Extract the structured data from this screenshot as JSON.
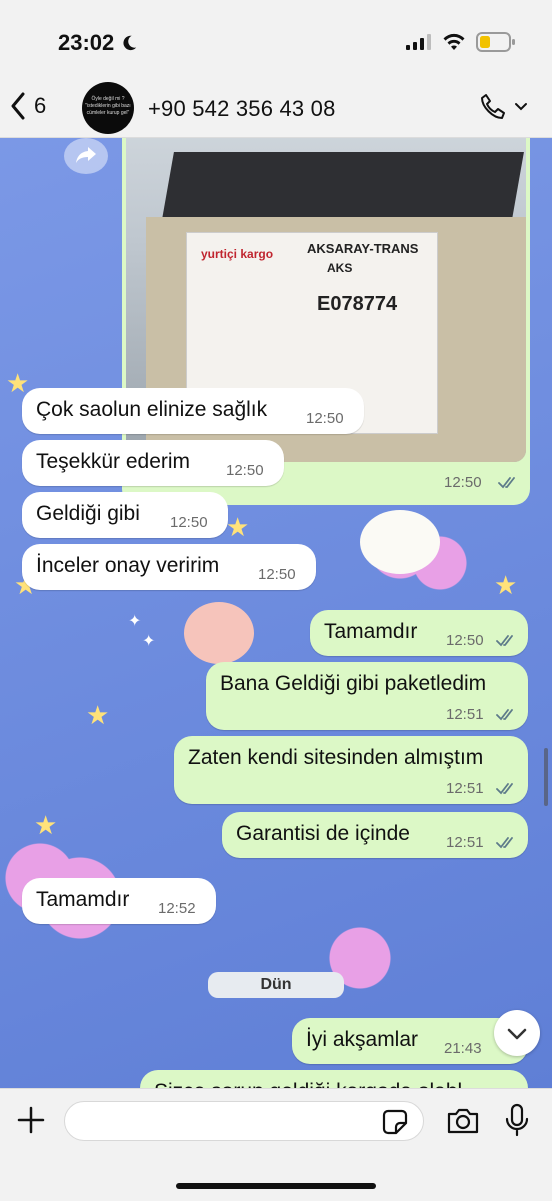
{
  "status": {
    "time": "23:02"
  },
  "header": {
    "back_count": "6",
    "contact": "+90 542 356 43 08",
    "avatar_text": "Öyle değil mi ? \"istediklerin gibi bazı cümleler kurup gel\""
  },
  "photo": {
    "label_title": "AKSARAY-TRANS",
    "label_sub": "AKS",
    "label_logo": "yurtiçi kargo",
    "label_code": "E078774",
    "time": "12:50"
  },
  "messages": [
    {
      "text": "Çok saolun elinize sağlık",
      "time": "12:50"
    },
    {
      "text": "Teşekkür ederim",
      "time": "12:50"
    },
    {
      "text": "Geldiği gibi",
      "time": "12:50"
    },
    {
      "text": "İnceler onay veririm",
      "time": "12:50"
    },
    {
      "text": "Tamamdır",
      "time": "12:50"
    },
    {
      "text": "Bana Geldiği gibi paketledim",
      "time": "12:51"
    },
    {
      "text": "Zaten kendi sitesinden almıştım",
      "time": "12:51"
    },
    {
      "text": "Garantisi de içinde",
      "time": "12:51"
    },
    {
      "text": "Tamamdır",
      "time": "12:52"
    },
    {
      "text": "İyi akşamlar",
      "time": "21:43"
    },
    {
      "text": "Sizce sorun geldiği kargoda olabl",
      "time": ""
    }
  ],
  "date_divider": "Dün",
  "composer": {
    "placeholder": ""
  },
  "colors": {
    "outgoing": "#dcf8c6",
    "incoming": "#ffffff",
    "read_ticks": "#5e7b8a"
  },
  "icons": [
    "moon-icon",
    "signal-icon",
    "wifi-icon",
    "battery-icon",
    "back-chevron-icon",
    "phone-icon",
    "chevron-down-icon",
    "forward-icon",
    "double-check-icon",
    "plus-icon",
    "sticker-icon",
    "camera-icon",
    "mic-icon"
  ]
}
